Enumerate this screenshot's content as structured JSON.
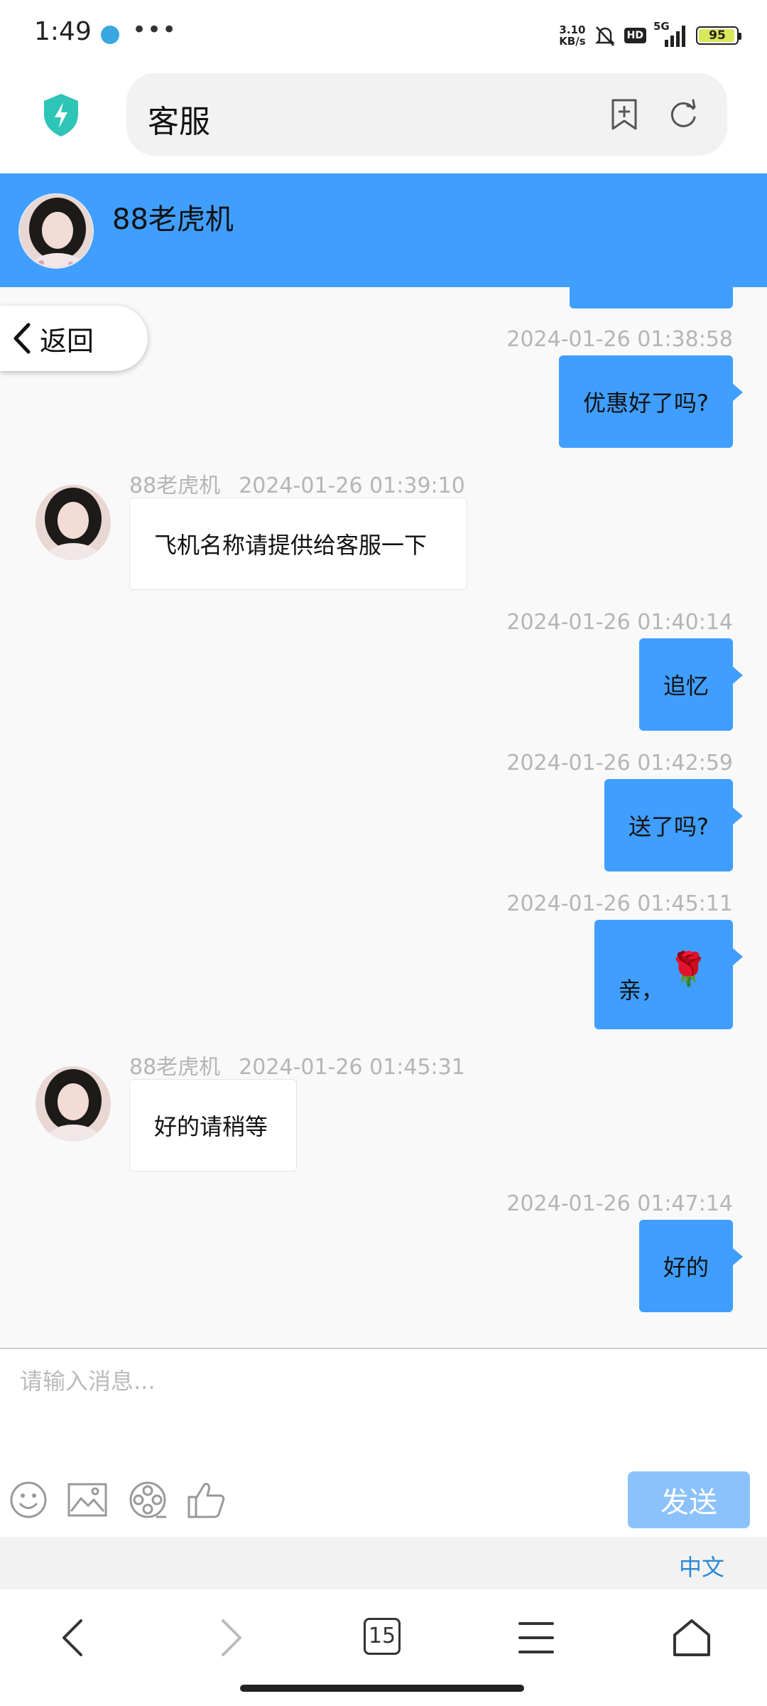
{
  "status": {
    "time": "1:49",
    "dots": "•••",
    "net_speed_value": "3.10",
    "net_speed_unit": "KB/s",
    "hd": "HD",
    "network": "5G",
    "battery": "95"
  },
  "browser": {
    "address_text": "客服"
  },
  "chat": {
    "title": "88老虎机",
    "back_label": "返回",
    "messages": [
      {
        "side": "out",
        "time": "2024-01-26 01:38:58",
        "text": "优惠好了吗?"
      },
      {
        "side": "in",
        "sender": "88老虎机",
        "time": "2024-01-26 01:39:10",
        "text": "飞机名称请提供给客服一下"
      },
      {
        "side": "out",
        "time": "2024-01-26 01:40:14",
        "text": "追忆"
      },
      {
        "side": "out",
        "time": "2024-01-26 01:42:59",
        "text": "送了吗?"
      },
      {
        "side": "out",
        "time": "2024-01-26 01:45:11",
        "text": "亲，",
        "emoji": "🌹"
      },
      {
        "side": "in",
        "sender": "88老虎机",
        "time": "2024-01-26 01:45:31",
        "text": "好的请稍等"
      },
      {
        "side": "out",
        "time": "2024-01-26 01:47:14",
        "text": "好的"
      }
    ]
  },
  "input": {
    "placeholder": "请输入消息...",
    "send_label": "发送"
  },
  "language": {
    "label": "中文"
  },
  "nav": {
    "tabs_count": "15"
  },
  "colors": {
    "accent": "#409eff",
    "send_disabled": "#8cc2fb",
    "shield": "#2ec4b6"
  }
}
